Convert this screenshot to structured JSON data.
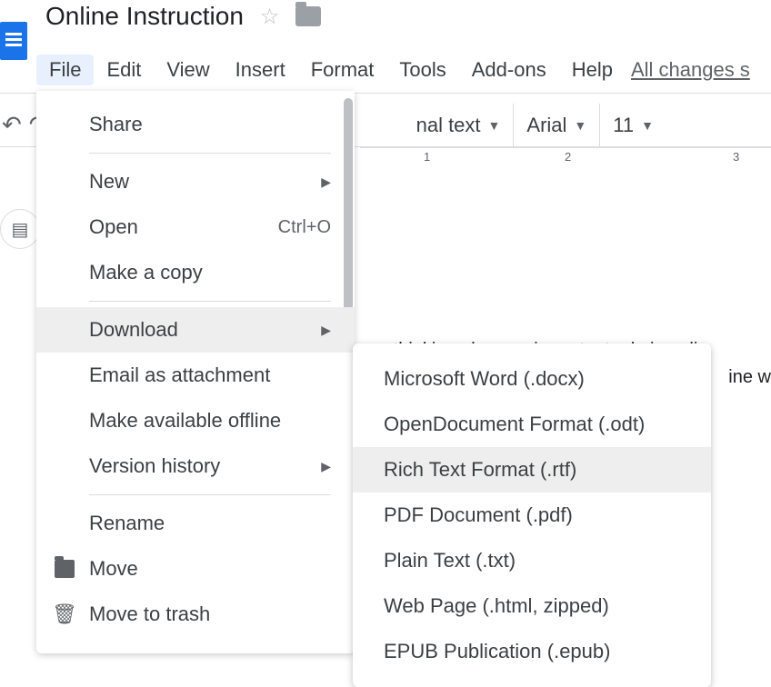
{
  "header": {
    "title": "Online Instruction",
    "saved_status": "All changes s"
  },
  "menubar": {
    "file": "File",
    "edit": "Edit",
    "view": "View",
    "insert": "Insert",
    "format": "Format",
    "tools": "Tools",
    "addons": "Add-ons",
    "help": "Help"
  },
  "toolbar": {
    "style": "nal text",
    "font": "Arial",
    "font_size": "11"
  },
  "ruler": {
    "n1": "1",
    "n2": "2",
    "n3": "3"
  },
  "doc": {
    "line1": "n thinking plays an important role in onli",
    "line2": "ine w"
  },
  "file_menu": {
    "share": "Share",
    "new": "New",
    "open": "Open",
    "open_shortcut": "Ctrl+O",
    "makecopy": "Make a copy",
    "download": "Download",
    "email": "Email as attachment",
    "offline": "Make available offline",
    "version": "Version history",
    "rename": "Rename",
    "move": "Move",
    "trash": "Move to trash"
  },
  "download_menu": {
    "docx": "Microsoft Word (.docx)",
    "odt": "OpenDocument Format (.odt)",
    "rtf": "Rich Text Format (.rtf)",
    "pdf": "PDF Document (.pdf)",
    "txt": "Plain Text (.txt)",
    "html": "Web Page (.html, zipped)",
    "epub": "EPUB Publication (.epub)"
  }
}
